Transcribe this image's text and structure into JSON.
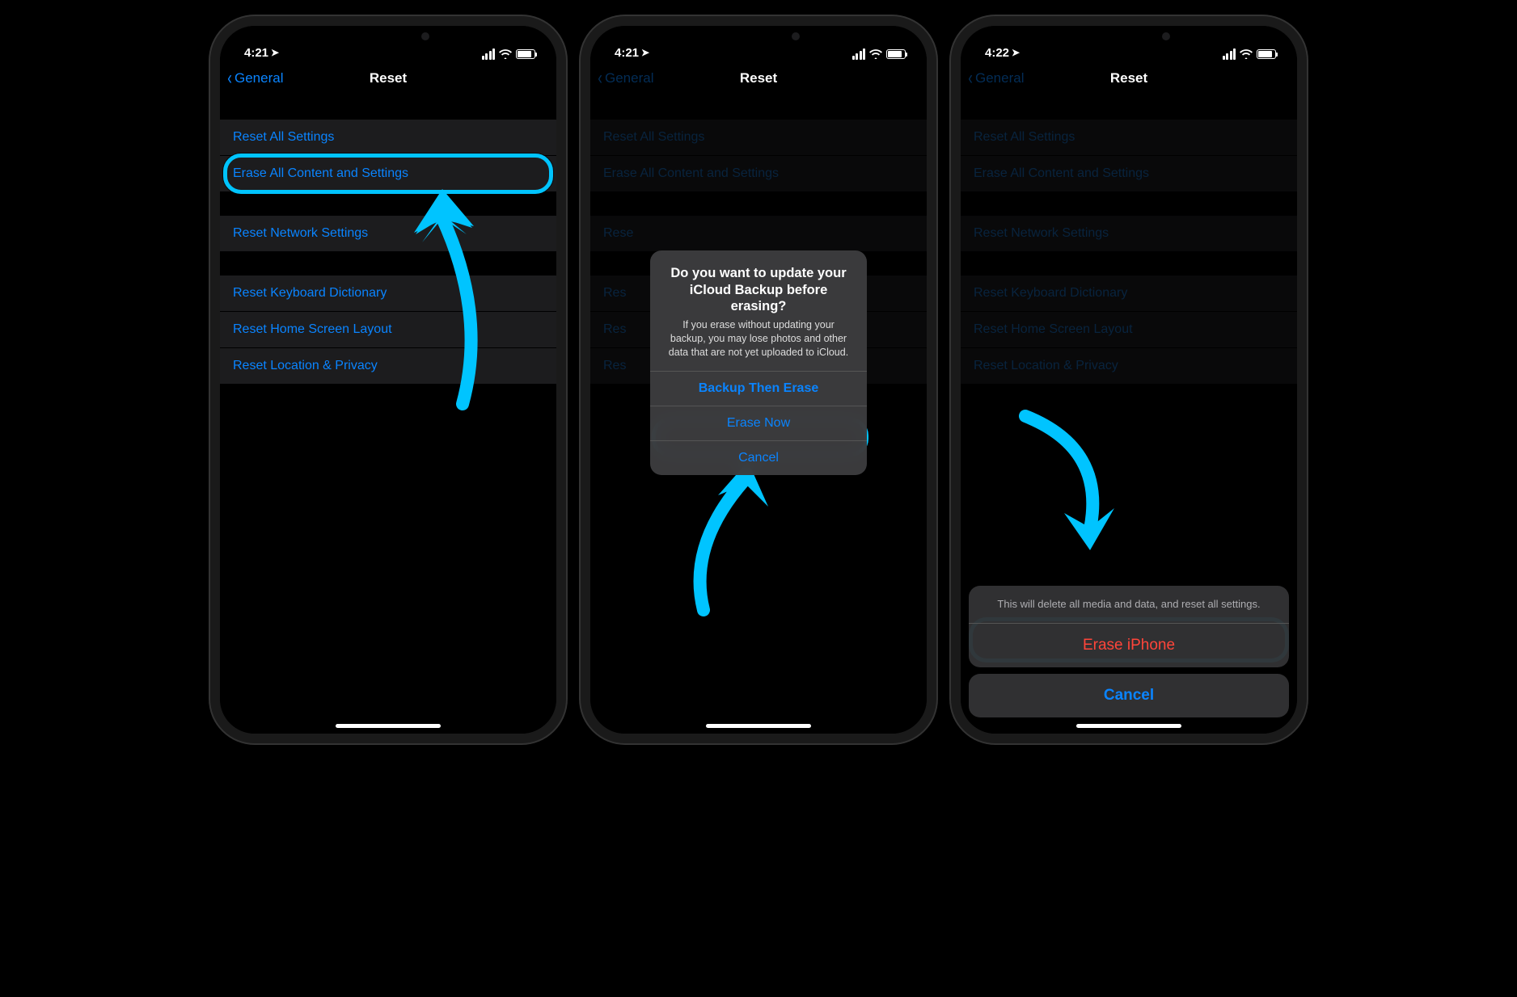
{
  "colors": {
    "accent": "#0a84ff",
    "highlight": "#00c4ff",
    "destructive": "#ff453a"
  },
  "status": {
    "time_a": "4:21",
    "time_b": "4:21",
    "time_c": "4:22",
    "location_icon": "location-arrow"
  },
  "nav": {
    "back_label": "General",
    "title": "Reset"
  },
  "groups": [
    {
      "items": [
        {
          "key": "reset-all",
          "label": "Reset All Settings"
        },
        {
          "key": "erase-all",
          "label": "Erase All Content and Settings"
        }
      ]
    },
    {
      "items": [
        {
          "key": "reset-network",
          "label": "Reset Network Settings"
        }
      ]
    },
    {
      "items": [
        {
          "key": "reset-keyboard",
          "label": "Reset Keyboard Dictionary"
        },
        {
          "key": "reset-home",
          "label": "Reset Home Screen Layout"
        },
        {
          "key": "reset-location",
          "label": "Reset Location & Privacy"
        }
      ]
    }
  ],
  "alert": {
    "title": "Do you want to update your iCloud Backup before erasing?",
    "message": "If you erase without updating your backup, you may lose photos and other data that are not yet uploaded to iCloud.",
    "buttons": {
      "backup": "Backup Then Erase",
      "erase": "Erase Now",
      "cancel": "Cancel"
    }
  },
  "sheet": {
    "message": "This will delete all media and data, and reset all settings.",
    "erase": "Erase iPhone",
    "cancel": "Cancel"
  },
  "truncated": {
    "rese": "Rese",
    "res": "Res"
  }
}
